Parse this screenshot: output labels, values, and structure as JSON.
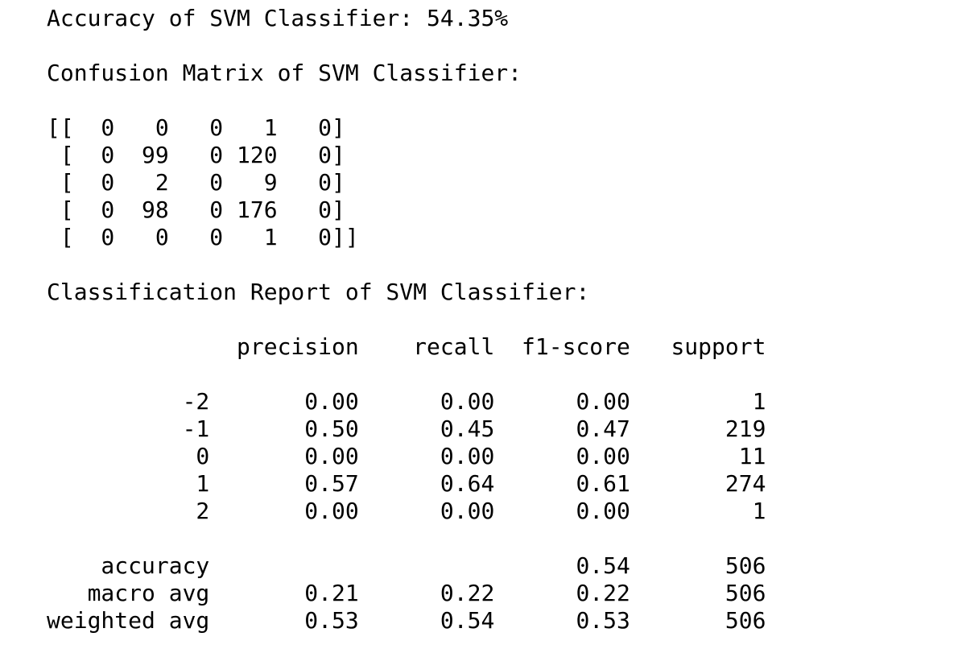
{
  "output": {
    "accuracy_line": "Accuracy of SVM Classifier: 54.35%",
    "confusion_title": "Confusion Matrix of SVM Classifier:",
    "confusion_rows": [
      "[[  0   0   0   1   0]",
      " [  0  99   0 120   0]",
      " [  0   2   0   9   0]",
      " [  0  98   0 176   0]",
      " [  0   0   0   1   0]]"
    ],
    "report_title": "Classification Report of SVM Classifier:",
    "report_header": "              precision    recall  f1-score   support",
    "report_rows": [
      "          -2       0.00      0.00      0.00         1",
      "          -1       0.50      0.45      0.47       219",
      "           0       0.00      0.00      0.00        11",
      "           1       0.57      0.64      0.61       274",
      "           2       0.00      0.00      0.00         1"
    ],
    "summary_rows": [
      "    accuracy                           0.54       506",
      "   macro avg       0.21      0.22      0.22       506",
      "weighted avg       0.53      0.54      0.53       506"
    ]
  }
}
